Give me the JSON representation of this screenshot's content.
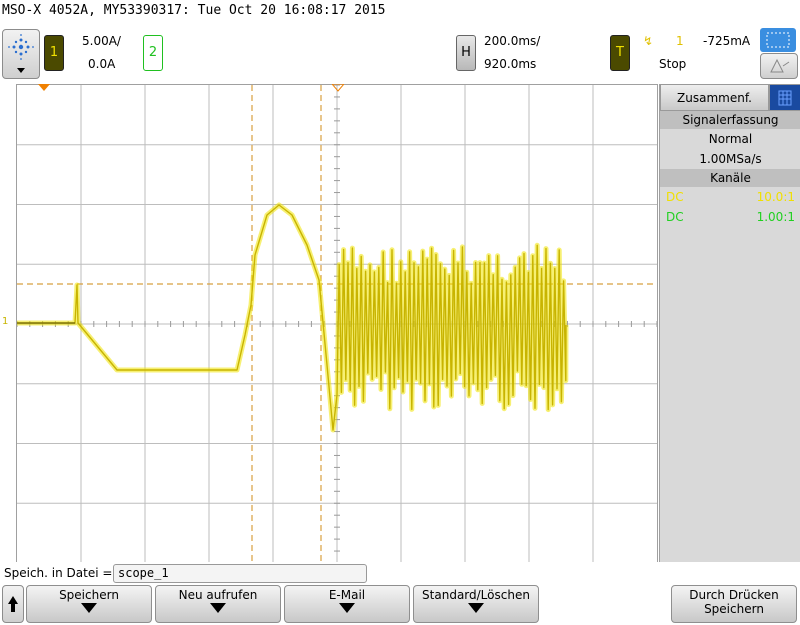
{
  "header": {
    "title": "MSO-X 4052A, MY53390317: Tue Oct 20 16:08:17 2015",
    "ch1": {
      "number": "1",
      "scale": "5.00A/",
      "offset": "0.0A"
    },
    "ch2": {
      "number": "2"
    },
    "horizontal": {
      "label": "H",
      "timebase": "200.0ms/",
      "delay": "920.0ms"
    },
    "trigger": {
      "label": "T",
      "slope_symbol": "↯",
      "source": "1",
      "level": "-725mA",
      "status": "Stop"
    }
  },
  "panel": {
    "tab_label": "Zusammenf.",
    "acq_header": "Signalerfassung",
    "acq_mode": "Normal",
    "sample_rate": "1.00MSa/s",
    "channels_header": "Kanäle",
    "channels": [
      {
        "coupling": "DC",
        "probe": "10.0:1",
        "color": "#f0e000"
      },
      {
        "coupling": "DC",
        "probe": "1.00:1",
        "color": "#20d020"
      }
    ]
  },
  "bottom": {
    "file_label": "Speich. in Datei =",
    "file_value": "scope_1",
    "softkeys": [
      "Speichern",
      "Neu aufrufen",
      "E-Mail",
      "Standard/Löschen"
    ],
    "print_line1": "Durch Drücken",
    "print_line2": "Speichern"
  },
  "colors": {
    "trace": "#c8b400",
    "grid": "#bdbdbd",
    "cursor": "#d8a040",
    "trigger_marker": "#f08000"
  }
}
